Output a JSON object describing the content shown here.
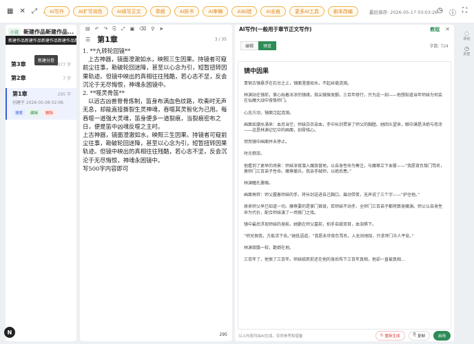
{
  "topbar": {
    "icons": [
      "grid-icon",
      "close-icon",
      "expand-icon",
      "search-icon"
    ],
    "buttons": [
      "AI写作",
      "AI扩写润色",
      "AI续写正文",
      "章纲",
      "AI拆书",
      "AI审稿",
      "AI纠错",
      "AI去痕",
      "更多AI工具",
      "剧本改编"
    ],
    "saved": "最后保存: 2026-05-17 03:03:26"
  },
  "left": {
    "tag": "小说",
    "work_title": "新建作品新建作品...",
    "tooltip_title": "新建作品新建作品新建作品新建作品新建作品",
    "tooltip_add": "新建分卷",
    "chapters": [
      {
        "title": "第3章",
        "count": "1077 字"
      },
      {
        "title": "第2章",
        "count": "7 字"
      }
    ],
    "selected": {
      "title": "第1章",
      "count": "295 字",
      "date": "创建于 2026-05-08 02:06",
      "actions": [
        "搜索",
        "编辑",
        "删除"
      ]
    }
  },
  "avatar": "N",
  "editor": {
    "title": "第1章",
    "count": "3 / 35",
    "paragraphs": [
      "1. **九转轮回镜**\n   上古神器，镜面澄澈如水，映照三生因果。持镜者可窥前尘往事，勘破轮回迷障，甚至以心念为引，短暂扭转因果轨迹。但镜中映出的真相往往残酷，若心志不坚，反会沉沦于无尽悔恨，神魂永困镜中。",
      "",
      "2. **噬灵骨笛**\n   以远古凶兽脊骨炼制，笛身布满血色纹路，吹奏时无声无息，却能直接撕裂生灵神魂，吞噬其灵智化为己用。每吞噬一道强大灵魂，笛身便多一道裂痕，当裂痕密布之日，便是笛中凶魂反噬之主时。",
      "",
      "上古神器，镜面澄澈如水，映照三生因果。持镜者可窥前尘往事，勘破轮回迷障，甚至以心念为引，短暂扭转因果轨迹。但镜中映出的真相往往残酷，若心志不坚，反会沉沦于无尽悔恨，神魂永困镜中。\n写500字内容即可"
    ],
    "footer": "295"
  },
  "right": {
    "title": "AI写作(一般用于章节正文写作)",
    "guide": "教程",
    "tabs": [
      "编辑",
      "预览"
    ],
    "word_count": "字数: 724",
    "heading": "镜中因果",
    "paragraphs": [
      "青铜古镜悬浮在石台之上，镜面澄澈如水，不起丝毫涟漪。",
      "林渊站在镜前，掌心贴着冰凉的镜缘，指尖微微发颤。三百年修行，只为这一刻——他想知道当年师妹为何会在仙魔大战中背叛师门。",
      "心念方动，镜面泛起涟漪。",
      "画面如潮水涌来：血月当空，师妹白衣染血，手中长剑贯穿了师父的胸膛。她回头望来，眼中满是决绝与悲凉——这是林渊记忆中的画面，刻骨铭心。",
      "然而镜中画面并未停止。",
      "时光倒流。",
      "他看到了更早的场景：师妹深夜潜入魔族营地，以自身性命为筹注，与魔尊立下血誓——“我愿背负叛门骂名，换师门三百弟子性命。魔尊撤兵，我亲手弑师，以绝后患。”",
      "林渊瞳孔骤缩。",
      "画面再转：师父握着师妹的手，将长剑送进自己胸口，眉动带笑，无声说了三个字——“护住他。”",
      "原来师父早已知道一切。魔尊要的是掌门首级，若师妹不动手，全师门三百弟子都将葬身魔渊。师父以自身性命为代价，配合师妹演了一场叛门之戏。",
      "镜中最后浮现师妹的身影。她跪在师父墓前，拍手自毁双目，血泪俱下。",
      "“师兄恨我，方能活下去。”她低语道，“我愿永世背负骂名，入无间地狱，只求师门众人平安。”",
      "林渊双膝一软，跪倒在地。",
      "三百年了，他恨了三百年。师妹临死前还在他的身后布下三百年真相，他却一直被真相..."
    ],
    "footer_note": "以上内容均由AI生成，仅供参考和借鉴",
    "buttons": [
      "重新生成",
      "复制",
      "启用"
    ]
  },
  "rail": [
    "评论",
    "历史"
  ]
}
